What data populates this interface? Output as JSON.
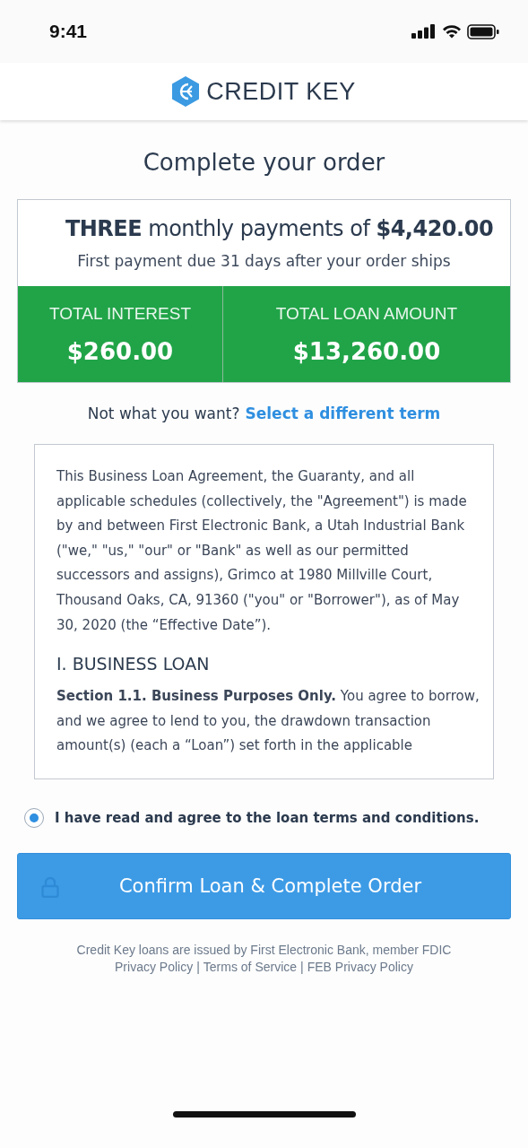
{
  "status_bar": {
    "time": "9:41"
  },
  "header": {
    "logo_text": "CREDIT KEY"
  },
  "title": "Complete your order",
  "summary": {
    "headline": "**THREE** monthly payments of **$4,420.00**",
    "subline": "First payment due 31 days after your order ships",
    "totals": [
      {
        "label": "TOTAL INTEREST",
        "value": "$260.00"
      },
      {
        "label": "TOTAL LOAN AMOUNT",
        "value": "$13,260.00"
      }
    ]
  },
  "change_term": {
    "prompt": "Not what you want?",
    "link": "Select a different term"
  },
  "agreement": {
    "intro": "This Business Loan Agreement, the Guaranty, and all applicable schedules (collectively, the \"Agreement\") is made by and between First Electronic Bank, a Utah Industrial Bank (\"we,\" \"us,\" \"our\" or \"Bank\" as well as our permitted successors and assigns), Grimco at 1980 Millville Court, Thousand Oaks, CA, 91360 (\"you\" or \"Borrower\"), as of May 30, 2020 (the “Effective Date”).",
    "heading": "I. BUSINESS LOAN",
    "section": "**Section 1.1. Business Purposes Only.** You agree to borrow, and we agree to lend to you, the drawdown transaction amount(s) (each a “Loan”) set forth in the applicable"
  },
  "consent": {
    "label": "I have read and agree to the loan terms and conditions.",
    "selected": true
  },
  "confirm_button": "Confirm Loan & Complete Order",
  "footer": {
    "note": "Credit Key loans are issued by First Electronic Bank, member FDIC",
    "separator": "|",
    "links": [
      "Privacy Policy",
      "Terms of Service",
      "FEB Privacy Policy"
    ]
  }
}
